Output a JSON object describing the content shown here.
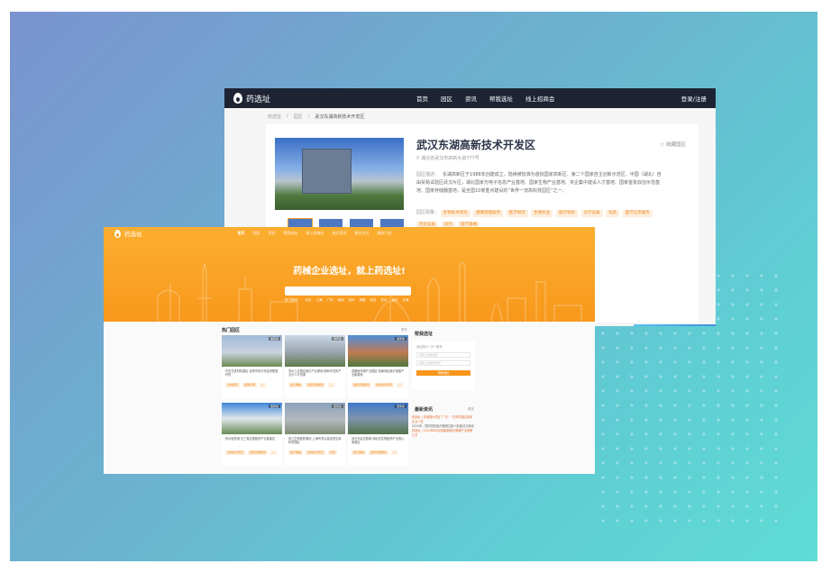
{
  "back_page": {
    "brand": "药选址",
    "nav": [
      "首页",
      "园区",
      "资讯",
      "帮我选址",
      "线上招商会"
    ],
    "login": "登录/注册",
    "breadcrumb": [
      "药选址",
      "园区",
      "武汉东湖高新技术开发区"
    ],
    "park_title": "武汉东湖高新技术开发区",
    "favorite": "收藏园区",
    "address": "湖北省武汉市高新大道777号",
    "description_label": "园区描述：",
    "description": "东湖高新区于1988年创建成立，陆续被批准为首批国家高新区、第二个国家自主创新示范区、中国（湖北）自由贸易试验区武汉片区，湖北国家光电子信息产业基地、国家生物产业基地、央企集中建设人才基地、国家首批双创示范基地、国家存储器基地，是全国10家重点建设的“世界一流高科技园区”之一。",
    "policy_label": "园区政策：",
    "tags": [
      "生物技术研究",
      "健康管理服务",
      "医学研究",
      "生物农业",
      "医疗机构",
      "诊疗设备",
      "化药",
      "医疗信息服务",
      "检验设备",
      "试剂",
      "医疗器械"
    ]
  },
  "front_page": {
    "brand": "药选址",
    "nav": [
      "首页",
      "园区",
      "资讯",
      "帮我选址",
      "线上招商会",
      "热点资讯",
      "联系方式",
      "服务介绍"
    ],
    "slogan": "药械企业选址，就上药选址!",
    "hot_cities": [
      "热门城市：",
      "北京",
      "上海",
      "广州",
      "深圳",
      "杭州",
      "成都",
      "武汉",
      "苏州",
      "南京",
      "天津"
    ],
    "hot_parks_title": "热门园区",
    "more": "更多",
    "parks": [
      {
        "badge": "国家级",
        "desc": "华东先进材料园区 优质市场与完善的配套环境",
        "tags": [
          "生物医药",
          "健康管理",
          "…"
        ]
      },
      {
        "badge": "国家级",
        "desc": "苏州工业园区医疗产业基地 拥有丰富的产业与人才资源",
        "tags": [
          "医疗器械",
          "健康管理服务",
          "…"
        ]
      },
      {
        "badge": "国家级",
        "desc": "成都医学城产业园区 西南地区医疗健康产业聚集地",
        "tags": [
          "健康管理服务",
          "生物技术研究",
          "…"
        ]
      },
      {
        "badge": "国家级",
        "desc": "杭州医药港 长三角生物医药产业集聚区",
        "tags": [
          "生物技术研究",
          "健康管理服务",
          "…"
        ]
      },
      {
        "badge": "国家级",
        "desc": "张江生物医药基地 上海市重点建设的生命科学园区",
        "tags": [
          "医疗器械",
          "生物技术研究",
          "化药"
        ]
      },
      {
        "badge": "国家级",
        "desc": "武汉光谷生物城 湖北省生物医药产业核心承载区",
        "tags": [
          "医疗器械",
          "健康管理服务",
          "…"
        ]
      }
    ],
    "help_title": "帮我选址",
    "help_lines": [
      "选址顾问一对一服务"
    ],
    "help_inputs": [
      "请输入您的姓名",
      "请输入您的手机号"
    ],
    "help_button": "帮我选址",
    "news_title": "最新资讯",
    "news_items": [
      "药选址 | 粤港澳大湾区“广东”：中关村园区新增企业入驻",
      "2020年，国内首批医疗器械注册人制度试点落地",
      "药选址 | 2020年8月全国最新医疗器械产业政策汇总"
    ]
  }
}
